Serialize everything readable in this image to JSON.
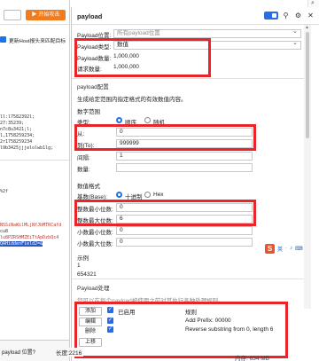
{
  "left": {
    "dropdown_label": "",
    "start_button": "开始攻击",
    "host_checkbox_label": "更新Host报头来匹配目标",
    "lines": [
      "ll:l7582392l;",
      "27:35239;",
      "n7c8u3421;l;",
      "l,1758259234;",
      "2r1758259234",
      "l9b3425jjjelolwb1lg;",
      "%2f",
      "NSSiNaWilMLjNfJbMTRCafd",
      "cu8",
      "lu8PZRSHMZEiTtApDzbQc4",
      "QAHiddenField2=&"
    ],
    "bottom_text": "payload 位置?"
  },
  "dialog": {
    "title": "payload",
    "header": {
      "position_label": "Payload位置:",
      "position_value": "所有payload位置",
      "type_label": "Payload类型:",
      "type_value": "数值",
      "count_label": "Payload数量:",
      "count_value": "1,000,000",
      "request_label": "请求数量:",
      "request_value": "1,000,000"
    },
    "config": {
      "section_title": "payload配置",
      "description": "生成给定范围内指定格式的有效数值内容。",
      "range_title": "数字范围",
      "type_label": "类型:",
      "seq_label": "顺序",
      "random_label": "随机",
      "from_label": "从:",
      "from_value": "0",
      "to_label": "到(To):",
      "to_value": "999999",
      "step_label": "间隔:",
      "step_value": "1",
      "how_many_label": "数量:",
      "how_many_value": ""
    },
    "format": {
      "title": "数值格式",
      "base_label": "基数(Base):",
      "decimal_label": "十进制",
      "hex_label": "Hex",
      "min_int_label": "整数最小位数:",
      "min_int_value": "0",
      "max_int_label": "整数最大位数:",
      "max_int_value": "6",
      "min_frac_label": "小数最小位数:",
      "min_frac_value": "0",
      "max_frac_label": "小数最大位数:",
      "max_frac_value": "0",
      "example_title": "示例",
      "example_1": "1",
      "example_2": "654321"
    },
    "processing": {
      "title": "Payload处理",
      "description": "您可以在每个payload被使用之前对其执行各种处理规则。",
      "add_button": "添加",
      "edit_button": "编辑",
      "delete_button": "删除",
      "up_button": "上移",
      "col_enabled": "已启用",
      "col_rule": "规则",
      "rules": [
        "Add Prefix: 00000",
        "Reverse substring from 0, length 6"
      ]
    }
  },
  "left_status": {
    "length_label": "长度:2216"
  },
  "status_right": "内存: 634 MB",
  "toolbar": {
    "s_label": "S",
    "items": [
      "英",
      "·",
      "♪",
      "⌨",
      "♥"
    ]
  },
  "colors": {
    "accent": "#2d6cdf",
    "orange": "#f07c1d",
    "highlight_red": "#e8262a"
  }
}
